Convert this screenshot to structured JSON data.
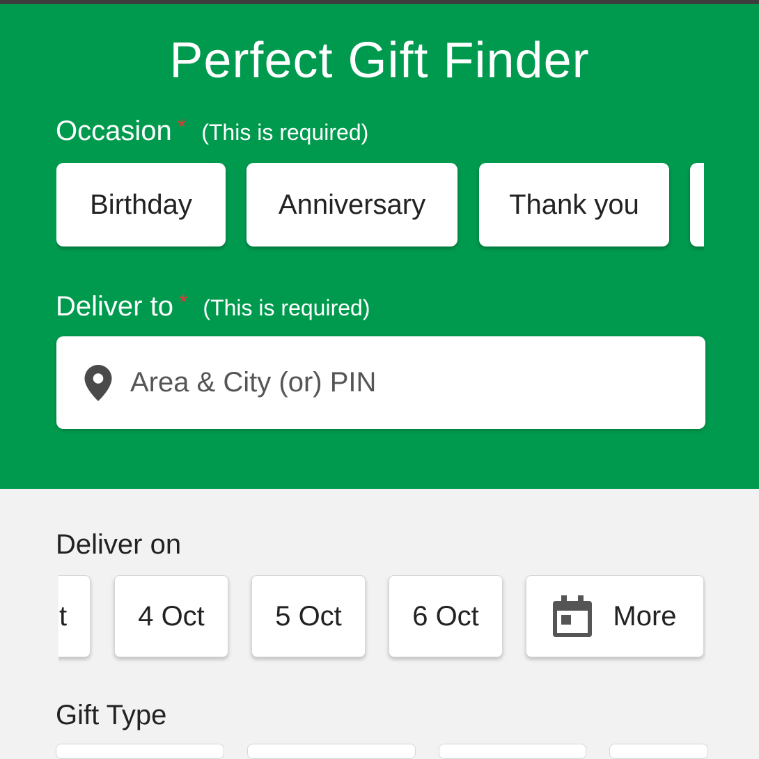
{
  "header": {
    "title": "Perfect Gift Finder"
  },
  "occasion": {
    "label": "Occasion",
    "required_star": "*",
    "required_note": "(This is required)",
    "options": [
      "Birthday",
      "Anniversary",
      "Thank you"
    ]
  },
  "deliver_to": {
    "label": "Deliver to",
    "required_star": "*",
    "required_note": "(This is required)",
    "placeholder": "Area & City (or) PIN"
  },
  "deliver_on": {
    "label": "Deliver on",
    "partial_date": "t",
    "dates": [
      "4 Oct",
      "5 Oct",
      "6 Oct"
    ],
    "more_label": "More"
  },
  "gift_type": {
    "label": "Gift Type"
  },
  "colors": {
    "primary": "#009a4e",
    "required": "#e53935",
    "background": "#f2f2f2"
  }
}
